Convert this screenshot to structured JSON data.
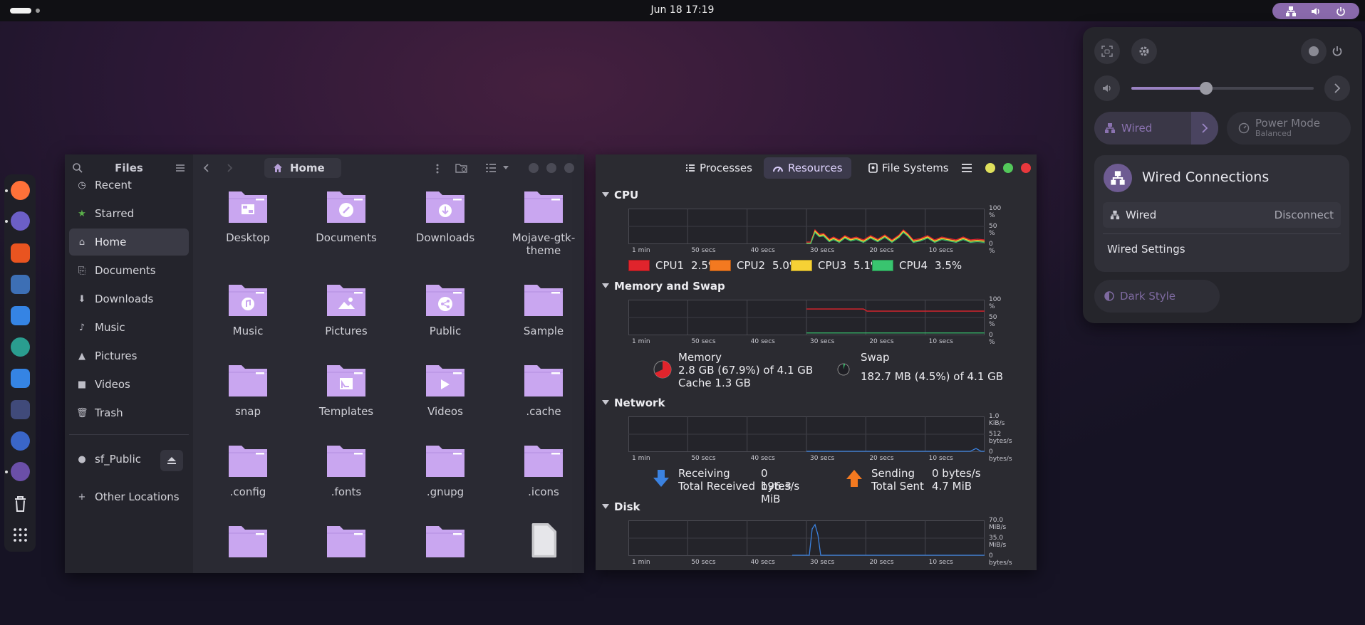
{
  "topbar": {
    "clock": "Jun 18  17:19",
    "icons": [
      "network-icon",
      "volume-icon",
      "power-icon"
    ]
  },
  "dock": {
    "apps": [
      "firefox-icon",
      "thunderbird-icon",
      "app-center-icon",
      "help-icon",
      "extensions-icon",
      "disk-icon",
      "text-editor-icon",
      "terminal-icon",
      "settings-icon",
      "system-monitor-icon",
      "trash-icon",
      "app-grid-icon"
    ]
  },
  "files": {
    "title": "Files",
    "location": "Home",
    "sidebar": [
      {
        "label": "Recent",
        "icon": "clock-icon"
      },
      {
        "label": "Starred",
        "icon": "star-icon"
      },
      {
        "label": "Home",
        "icon": "home-icon"
      },
      {
        "label": "Documents",
        "icon": "document-icon"
      },
      {
        "label": "Downloads",
        "icon": "download-icon"
      },
      {
        "label": "Music",
        "icon": "music-icon"
      },
      {
        "label": "Pictures",
        "icon": "picture-icon"
      },
      {
        "label": "Videos",
        "icon": "video-icon"
      },
      {
        "label": "Trash",
        "icon": "trash-icon"
      },
      {
        "label": "sf_Public",
        "icon": "drive-icon"
      },
      {
        "label": "Other Locations",
        "icon": "plus-icon"
      }
    ],
    "items": [
      {
        "name": "Desktop",
        "emblem": "desktop"
      },
      {
        "name": "Documents",
        "emblem": "clip"
      },
      {
        "name": "Downloads",
        "emblem": "download"
      },
      {
        "name": "Mojave-gtk-theme",
        "emblem": "plain",
        "label2": "theme",
        "label1": "Mojave-gtk-"
      },
      {
        "name": "Music",
        "emblem": "music"
      },
      {
        "name": "Pictures",
        "emblem": "picture"
      },
      {
        "name": "Public",
        "emblem": "share"
      },
      {
        "name": "Sample",
        "emblem": "plain"
      },
      {
        "name": "snap",
        "emblem": "plain"
      },
      {
        "name": "Templates",
        "emblem": "template"
      },
      {
        "name": "Videos",
        "emblem": "video"
      },
      {
        "name": ".cache",
        "emblem": "plain"
      },
      {
        "name": ".config",
        "emblem": "plain"
      },
      {
        "name": ".fonts",
        "emblem": "plain"
      },
      {
        "name": ".gnupg",
        "emblem": "plain"
      },
      {
        "name": ".icons",
        "emblem": "plain"
      },
      {
        "name": "",
        "emblem": "plain"
      },
      {
        "name": "",
        "emblem": "plain"
      },
      {
        "name": "",
        "emblem": "plain"
      },
      {
        "name": "",
        "emblem": "file"
      }
    ],
    "folder_color": "#c9a6f0"
  },
  "sysmon": {
    "tabs": [
      {
        "label": "Processes",
        "icon": "list-icon"
      },
      {
        "label": "Resources",
        "icon": "gauge-icon"
      },
      {
        "label": "File Systems",
        "icon": "disk-icon"
      }
    ],
    "selected_tab": "Resources",
    "xticks": [
      "1 min",
      "50 secs",
      "40 secs",
      "30 secs",
      "20 secs",
      "10 secs"
    ],
    "cpu": {
      "title": "CPU",
      "yticks": [
        "100 %",
        "50 %",
        "0 %"
      ],
      "legend": [
        {
          "name": "CPU1",
          "value": "2.5%",
          "color": "#e0242c"
        },
        {
          "name": "CPU2",
          "value": "5.0%",
          "color": "#f37920"
        },
        {
          "name": "CPU3",
          "value": "5.1%",
          "color": "#f6d135"
        },
        {
          "name": "CPU4",
          "value": "3.5%",
          "color": "#39c46f"
        }
      ]
    },
    "memory": {
      "title": "Memory and Swap",
      "yticks": [
        "100 %",
        "50 %",
        "0 %"
      ],
      "mem_label": "Memory",
      "mem_used": "2.8 GB (67.9%) of 4.1 GB",
      "mem_cache": "Cache 1.3 GB",
      "swap_label": "Swap",
      "swap_used": "182.7 MB (4.5%) of 4.1 GB",
      "mem_percent": 67.9,
      "swap_percent": 4.5
    },
    "network": {
      "title": "Network",
      "yticks": [
        "1.0 KiB/s",
        "512 bytes/s",
        "0 bytes/s"
      ],
      "recv_label": "Receiving",
      "recv_value": "0 bytes/s",
      "total_recv_label": "Total Received",
      "total_recv_value": "196.3 MiB",
      "send_label": "Sending",
      "send_value": "0 bytes/s",
      "total_sent_label": "Total Sent",
      "total_sent_value": "4.7 MiB"
    },
    "disk": {
      "title": "Disk",
      "yticks": [
        "70.0 MiB/s",
        "35.0 MiB/s",
        "0 bytes/s"
      ]
    }
  },
  "quick_settings": {
    "volume_percent": 41,
    "wired_label": "Wired",
    "power_mode_label": "Power Mode",
    "power_mode_value": "Balanced",
    "submenu_title": "Wired Connections",
    "connection_name": "Wired",
    "disconnect_label": "Disconnect",
    "settings_label": "Wired Settings",
    "dark_style_label": "Dark Style",
    "accent": "#8a6aac"
  }
}
